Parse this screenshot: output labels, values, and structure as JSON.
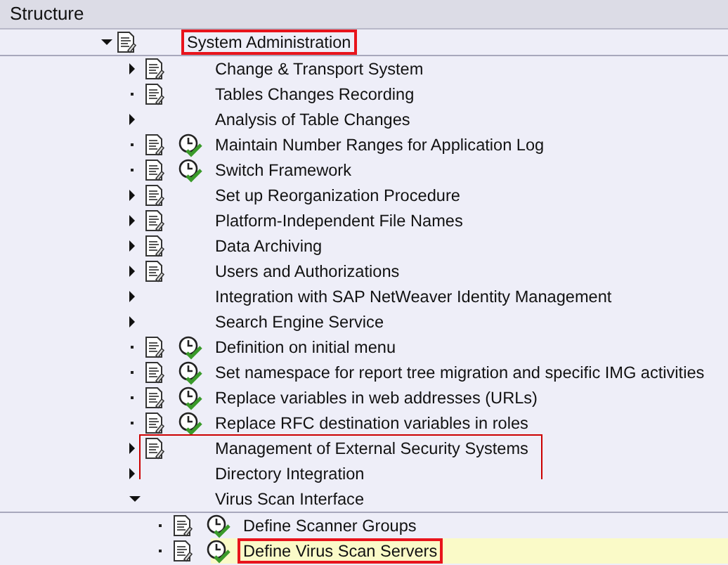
{
  "header": {
    "title": "Structure"
  },
  "tree": [
    {
      "label": "System Administration",
      "kind": "folder",
      "expanded": true,
      "doc": true,
      "clock": false,
      "selected": false,
      "marked": true,
      "children": [
        {
          "label": "Change & Transport System",
          "kind": "folder",
          "expanded": false,
          "doc": true,
          "clock": false,
          "selected": false,
          "marked": false
        },
        {
          "label": "Tables Changes Recording",
          "kind": "activity",
          "doc": true,
          "clock": false,
          "selected": false,
          "marked": false
        },
        {
          "label": "Analysis of Table Changes",
          "kind": "folder",
          "expanded": false,
          "doc": false,
          "clock": false,
          "selected": false,
          "marked": false
        },
        {
          "label": "Maintain Number Ranges for Application Log",
          "kind": "activity",
          "doc": true,
          "clock": true,
          "selected": false,
          "marked": false
        },
        {
          "label": "Switch Framework",
          "kind": "activity",
          "doc": true,
          "clock": true,
          "selected": false,
          "marked": false
        },
        {
          "label": "Set up Reorganization Procedure",
          "kind": "folder",
          "expanded": false,
          "doc": true,
          "clock": false,
          "selected": false,
          "marked": false
        },
        {
          "label": "Platform-Independent File Names",
          "kind": "folder",
          "expanded": false,
          "doc": true,
          "clock": false,
          "selected": false,
          "marked": false
        },
        {
          "label": "Data Archiving",
          "kind": "folder",
          "expanded": false,
          "doc": true,
          "clock": false,
          "selected": false,
          "marked": false
        },
        {
          "label": "Users and Authorizations",
          "kind": "folder",
          "expanded": false,
          "doc": true,
          "clock": false,
          "selected": false,
          "marked": false
        },
        {
          "label": "Integration with SAP NetWeaver Identity Management",
          "kind": "folder",
          "expanded": false,
          "doc": false,
          "clock": false,
          "selected": false,
          "marked": false
        },
        {
          "label": "Search Engine Service",
          "kind": "folder",
          "expanded": false,
          "doc": false,
          "clock": false,
          "selected": false,
          "marked": false
        },
        {
          "label": "Definition on initial menu",
          "kind": "activity",
          "doc": true,
          "clock": true,
          "selected": false,
          "marked": false
        },
        {
          "label": "Set namespace for report tree migration and specific IMG activities",
          "kind": "activity",
          "doc": true,
          "clock": true,
          "selected": false,
          "marked": false
        },
        {
          "label": "Replace variables in web addresses (URLs)",
          "kind": "activity",
          "doc": true,
          "clock": true,
          "selected": false,
          "marked": false
        },
        {
          "label": "Replace RFC destination variables in roles",
          "kind": "activity",
          "doc": true,
          "clock": true,
          "selected": false,
          "marked": false
        },
        {
          "label": "Management of External Security Systems",
          "kind": "folder",
          "expanded": false,
          "doc": true,
          "clock": false,
          "selected": false,
          "marked": false,
          "framed": true
        },
        {
          "label": "Directory Integration",
          "kind": "folder",
          "expanded": false,
          "doc": false,
          "clock": false,
          "selected": false,
          "marked": false
        },
        {
          "label": "Virus Scan Interface",
          "kind": "folder",
          "expanded": true,
          "doc": false,
          "clock": false,
          "selected": false,
          "marked": false,
          "children": [
            {
              "label": "Define Scanner Groups",
              "kind": "activity",
              "doc": true,
              "clock": true,
              "selected": false,
              "marked": false
            },
            {
              "label": "Define Virus Scan Servers",
              "kind": "activity",
              "doc": true,
              "clock": true,
              "selected": true,
              "marked": true
            }
          ]
        }
      ]
    }
  ]
}
